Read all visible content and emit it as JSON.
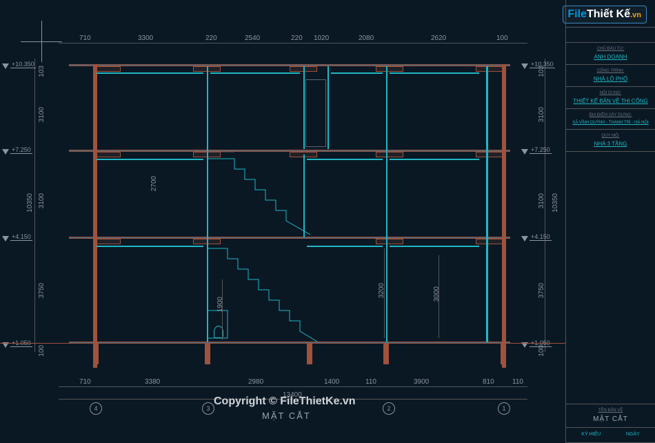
{
  "copyright": "Copyright © FileThietKe.vn",
  "drawing_title": "MẶT CẮT",
  "logo": {
    "part1": "File",
    "part2": "Thiết Kế",
    "part3": ".vn"
  },
  "dims_top": [
    "710",
    "3300",
    "220",
    "2540",
    "220",
    "1020",
    "2080",
    "2620",
    "100"
  ],
  "dims_bottom": [
    "710",
    "3380",
    "2980",
    "1400",
    "110",
    "3900",
    "810",
    "110"
  ],
  "dim_bottom_total": "13400",
  "dims_left": [
    "103",
    "3100",
    "3100",
    "3750",
    "100"
  ],
  "dims_left_total": "10350",
  "dims_right": [
    "103",
    "3100",
    "3100",
    "3750",
    "100"
  ],
  "dims_right_total": "10350",
  "inner_dims": {
    "h1": "1900",
    "h2": "3200",
    "h3": "3000",
    "stair_w": "2700"
  },
  "elevations": [
    "+10.350",
    "+7.250",
    "+4.150",
    "+1.050"
  ],
  "grid_marks": [
    "4",
    "3",
    "2",
    "1"
  ],
  "titleblock": {
    "client_lbl": "CHỦ ĐẦU TƯ:",
    "client": "ANH DOANH",
    "project_lbl": "CÔNG TRÌNH:",
    "project": "NHÀ LÔ PHỐ",
    "content_lbl": "NỘI DUNG:",
    "content": "THIẾT KẾ BẢN VẼ THI CÔNG",
    "addr_lbl": "ĐỊA ĐIỂM XÂY DỰNG:",
    "addr": "XÃ VĨNH QUỲNH - THANH TRÌ - HÀ NỘI",
    "scale_lbl": "QUY MÔ:",
    "scale": "NHÀ 3 TẦNG",
    "sheet_lbl": "TÊN BẢN VẼ",
    "sheet": "MẶT CẮT",
    "footer_lbl": "KÝ HIỆU",
    "footer_lbl2": "NGÀY"
  }
}
